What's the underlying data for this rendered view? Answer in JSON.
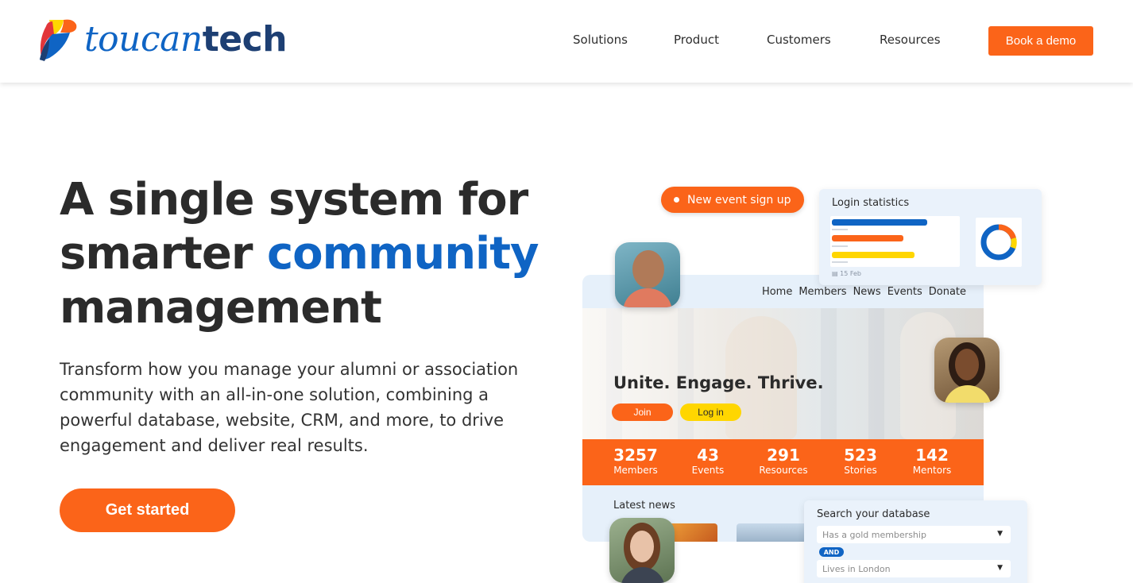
{
  "brand": {
    "name_part1": "toucan",
    "name_part2": "tech"
  },
  "nav": {
    "items": [
      "Solutions",
      "Product",
      "Customers",
      "Resources"
    ],
    "cta": "Book a demo"
  },
  "hero": {
    "title_line1": "A single system for",
    "title_line2_plain": "smarter ",
    "title_line2_accent": "community",
    "title_line3": "management",
    "description": "Transform how you manage your alumni or association community with an all-in-one solution, combining a powerful database, website, CRM, and more, to drive engagement and deliver real results.",
    "cta": "Get started"
  },
  "mockup": {
    "event_pill": "New event sign up",
    "login_stats": {
      "title": "Login statistics",
      "footer": "15 Feb"
    },
    "site_nav": [
      "Home",
      "Members",
      "News",
      "Events",
      "Donate"
    ],
    "tagline": "Unite. Engage. Thrive.",
    "join_label": "Join",
    "login_label": "Log in",
    "stats": [
      {
        "value": "3257",
        "label": "Members"
      },
      {
        "value": "43",
        "label": "Events"
      },
      {
        "value": "291",
        "label": "Resources"
      },
      {
        "value": "523",
        "label": "Stories"
      },
      {
        "value": "142",
        "label": "Mentors"
      }
    ],
    "latest_news": "Latest news",
    "search": {
      "title": "Search your database",
      "filter1": "Has a gold membership",
      "operator": "AND",
      "filter2": "Lives in London"
    }
  },
  "colors": {
    "accent": "#0f64c4",
    "orange": "#fb6419",
    "yellow": "#ffd600",
    "navy": "#1d3f73"
  }
}
